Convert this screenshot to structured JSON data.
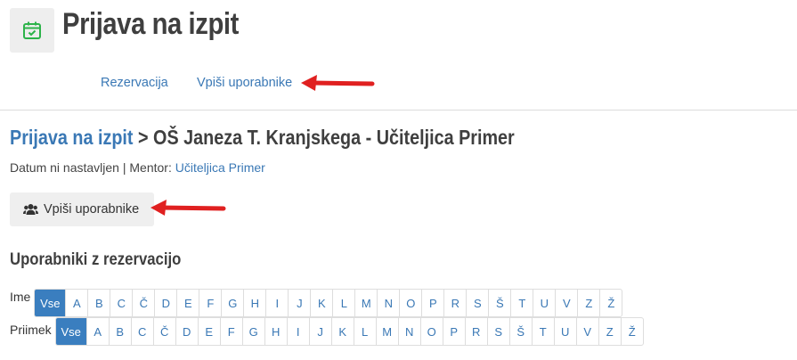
{
  "header": {
    "title": "Prijava na izpit",
    "nav": [
      "Rezervacija",
      "Vpiši uporabnike"
    ]
  },
  "breadcrumb": {
    "link": "Prijava na izpit",
    "separator": " > ",
    "current": "OŠ Janeza T. Kranjskega - Učiteljica Primer"
  },
  "meta": {
    "text": "Datum ni nastavljen | Mentor: ",
    "mentor": "Učiteljica Primer"
  },
  "action_button": {
    "label": "Vpiši uporabnike",
    "icon": "users-icon"
  },
  "section_title": "Uporabniki z rezervacijo",
  "filters": {
    "first_name_label": "Ime",
    "last_name_label": "Priimek",
    "all_label": "Vse",
    "letters": [
      "A",
      "B",
      "C",
      "Č",
      "D",
      "E",
      "F",
      "G",
      "H",
      "I",
      "J",
      "K",
      "L",
      "M",
      "N",
      "O",
      "P",
      "R",
      "S",
      "Š",
      "T",
      "U",
      "V",
      "Z",
      "Ž"
    ]
  },
  "colors": {
    "accent": "#3a78b5",
    "active_bg": "#3a7ebf",
    "arrow": "#e02020",
    "icon_green": "#2db34a"
  }
}
